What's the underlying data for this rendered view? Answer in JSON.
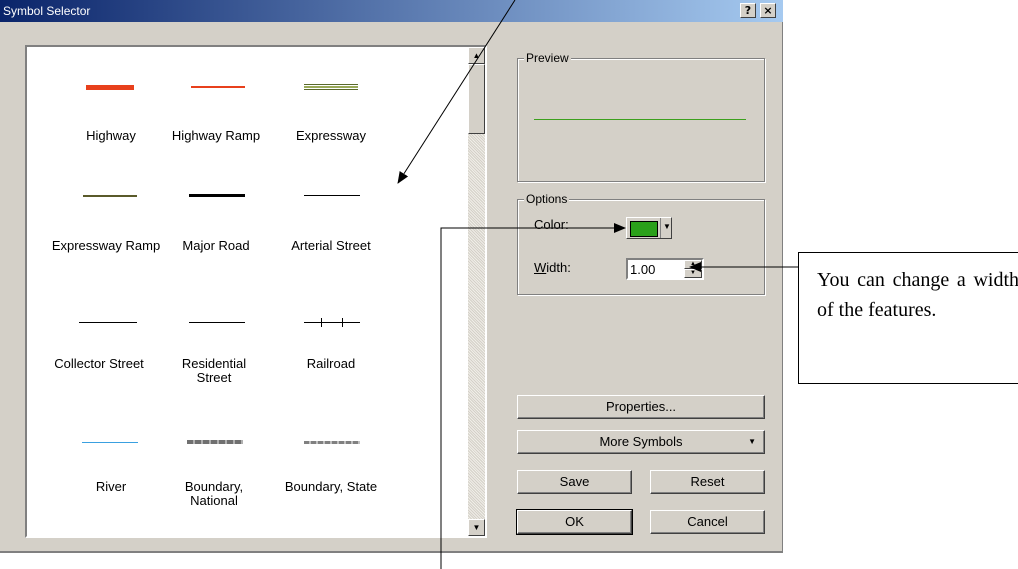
{
  "window": {
    "title": "Symbol Selector",
    "help_button": "?",
    "close_button": "×"
  },
  "symbols": [
    {
      "label": "Highway",
      "color": "#e8401c"
    },
    {
      "label": "Highway Ramp",
      "color": "#e8401c"
    },
    {
      "label": "Expressway",
      "color": "#5a6a2a"
    },
    {
      "label": "Expressway Ramp",
      "color": "#5a5a2a"
    },
    {
      "label": "Major Road",
      "color": "#000000"
    },
    {
      "label": "Arterial Street",
      "color": "#000000"
    },
    {
      "label": "Collector Street",
      "color": "#000000"
    },
    {
      "label": "Residential Street",
      "color": "#000000"
    },
    {
      "label": "Railroad",
      "color": "#000000"
    },
    {
      "label": "River",
      "color": "#3aa0e0"
    },
    {
      "label": "Boundary, National",
      "color": "#808080"
    },
    {
      "label": "Boundary, State",
      "color": "#808080"
    }
  ],
  "preview": {
    "label": "Preview",
    "line_color": "#3ca01e"
  },
  "options": {
    "label": "Options",
    "color_label": "Color:",
    "color_value": "#2aa01a",
    "width_label": "Width:",
    "width_value": "1.00"
  },
  "buttons": {
    "properties": "Properties...",
    "more_symbols": "More Symbols",
    "save": "Save",
    "reset": "Reset",
    "ok": "OK",
    "cancel": "Cancel"
  },
  "annotation": {
    "text": "You can change a width of the features."
  }
}
